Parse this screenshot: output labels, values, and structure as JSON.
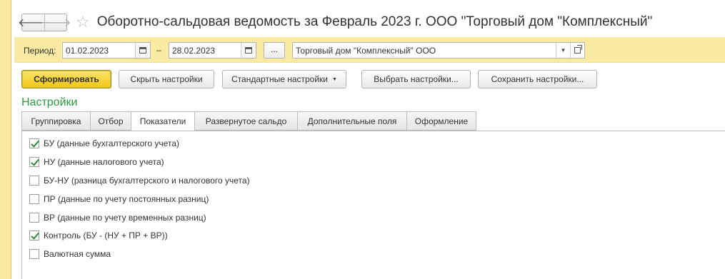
{
  "header": {
    "back_symbol": "🡐",
    "forward_symbol": "🡒",
    "star_symbol": "☆",
    "title": "Оборотно-сальдовая ведомость за Февраль 2023 г. ООО \"Торговый дом \"Комплексный\""
  },
  "period": {
    "label": "Период:",
    "date_from": "01.02.2023",
    "dash": "–",
    "date_to": "28.02.2023",
    "dots_label": "...",
    "organization": "Торговый дом \"Комплексный\" ООО"
  },
  "toolbar": {
    "generate_label": "Сформировать",
    "hide_settings_label": "Скрыть настройки",
    "standard_settings_label": "Стандартные настройки",
    "choose_settings_label": "Выбрать настройки...",
    "save_settings_label": "Сохранить настройки..."
  },
  "settings": {
    "title": "Настройки",
    "tabs": [
      {
        "label": "Группировка"
      },
      {
        "label": "Отбор"
      },
      {
        "label": "Показатели"
      },
      {
        "label": "Развернутое сальдо"
      },
      {
        "label": "Дополнительные поля"
      },
      {
        "label": "Оформление"
      }
    ],
    "active_tab": "Показатели",
    "indicators": [
      {
        "label": "БУ (данные бухгалтерского учета)",
        "checked": true
      },
      {
        "label": "НУ (данные налогового учета)",
        "checked": true
      },
      {
        "label": "БУ-НУ (разница бухгалтерского и налогового учета)",
        "checked": false
      },
      {
        "label": "ПР (данные по учету постоянных разниц)",
        "checked": false
      },
      {
        "label": "ВР (данные по учету временных разниц)",
        "checked": false
      },
      {
        "label": "Контроль (БУ - (НУ + ПР + ВР))",
        "checked": true
      },
      {
        "label": "Валютная сумма",
        "checked": false
      }
    ]
  },
  "colors": {
    "panel_yellow": "#fbeaa2",
    "primary_button": "#f2c715",
    "settings_green": "#2b9a3f",
    "check_green": "#2e8b3c"
  }
}
